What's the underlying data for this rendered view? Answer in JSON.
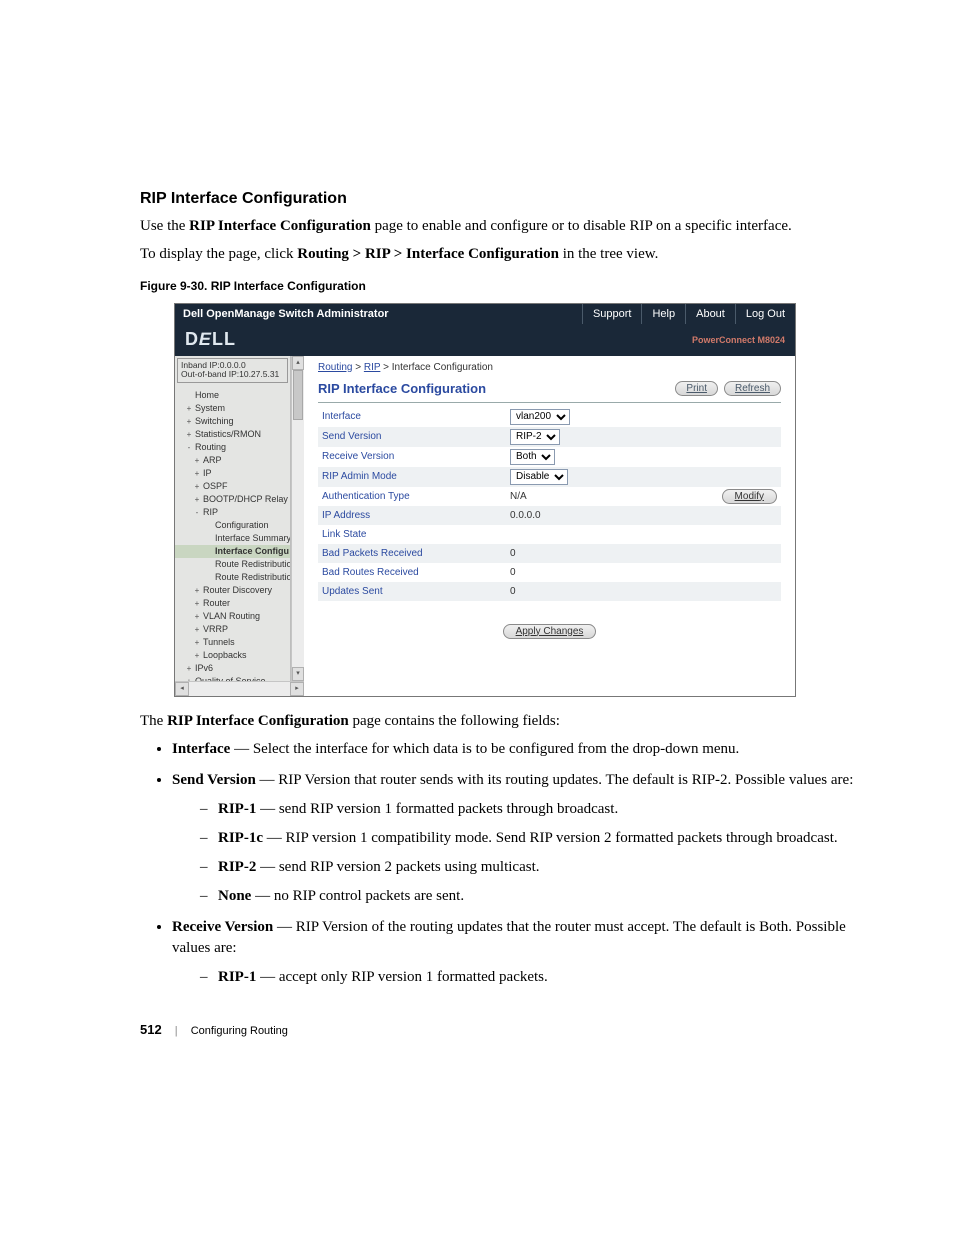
{
  "heading": "RIP Interface Configuration",
  "intro_pre": "Use the ",
  "intro_bold": "RIP Interface Configuration",
  "intro_post": " page to enable and configure or to disable RIP on a specific interface.",
  "nav_pre": "To display the page, click ",
  "nav_bold": "Routing > RIP > Interface Configuration",
  "nav_post": " in the tree view.",
  "figcap": "Figure 9-30.    RIP Interface Configuration",
  "ss": {
    "titlebar": {
      "title": "Dell OpenManage Switch Administrator",
      "links": [
        "Support",
        "Help",
        "About",
        "Log Out"
      ]
    },
    "brand": "DELL",
    "product": "PowerConnect M8024",
    "ipbox": {
      "inband": "Inband IP:0.0.0.0",
      "oob": "Out-of-band IP:10.27.5.31"
    },
    "tree": [
      {
        "lvl": 0,
        "exp": "",
        "label": "Home",
        "icon": "home-icon"
      },
      {
        "lvl": 0,
        "exp": "+",
        "label": "System"
      },
      {
        "lvl": 0,
        "exp": "+",
        "label": "Switching"
      },
      {
        "lvl": 0,
        "exp": "+",
        "label": "Statistics/RMON"
      },
      {
        "lvl": 0,
        "exp": "-",
        "label": "Routing"
      },
      {
        "lvl": 1,
        "exp": "+",
        "label": "ARP"
      },
      {
        "lvl": 1,
        "exp": "+",
        "label": "IP"
      },
      {
        "lvl": 1,
        "exp": "+",
        "label": "OSPF"
      },
      {
        "lvl": 1,
        "exp": "+",
        "label": "BOOTP/DHCP Relay"
      },
      {
        "lvl": 1,
        "exp": "-",
        "label": "RIP"
      },
      {
        "lvl": 2,
        "exp": "",
        "label": "Configuration"
      },
      {
        "lvl": 2,
        "exp": "",
        "label": "Interface Summary"
      },
      {
        "lvl": 2,
        "exp": "",
        "label": "Interface Configu",
        "sel": true
      },
      {
        "lvl": 2,
        "exp": "",
        "label": "Route Redistributio"
      },
      {
        "lvl": 2,
        "exp": "",
        "label": "Route Redistributio"
      },
      {
        "lvl": 1,
        "exp": "+",
        "label": "Router Discovery"
      },
      {
        "lvl": 1,
        "exp": "+",
        "label": "Router"
      },
      {
        "lvl": 1,
        "exp": "+",
        "label": "VLAN Routing"
      },
      {
        "lvl": 1,
        "exp": "+",
        "label": "VRRP"
      },
      {
        "lvl": 1,
        "exp": "+",
        "label": "Tunnels"
      },
      {
        "lvl": 1,
        "exp": "+",
        "label": "Loopbacks"
      },
      {
        "lvl": 0,
        "exp": "+",
        "label": "IPv6"
      },
      {
        "lvl": 0,
        "exp": "+",
        "label": "Quality of Service"
      }
    ],
    "breadcrumb": {
      "a": "Routing",
      "b": "RIP",
      "c": "Interface Configuration"
    },
    "pageTitle": "RIP Interface Configuration",
    "buttons": {
      "print": "Print",
      "refresh": "Refresh",
      "modify": "Modify",
      "apply": "Apply Changes"
    },
    "fields": [
      {
        "label": "Interface",
        "type": "select",
        "value": "vlan200"
      },
      {
        "label": "Send Version",
        "type": "select",
        "value": "RIP-2"
      },
      {
        "label": "Receive Version",
        "type": "select",
        "value": "Both"
      },
      {
        "label": "RIP Admin Mode",
        "type": "select",
        "value": "Disable"
      },
      {
        "label": "Authentication Type",
        "type": "textbtn",
        "value": "N/A"
      },
      {
        "label": "IP Address",
        "type": "text",
        "value": "0.0.0.0"
      },
      {
        "label": "Link State",
        "type": "text",
        "value": ""
      },
      {
        "label": "Bad Packets Received",
        "type": "text",
        "value": "0"
      },
      {
        "label": "Bad Routes Received",
        "type": "text",
        "value": "0"
      },
      {
        "label": "Updates Sent",
        "type": "text",
        "value": "0"
      }
    ]
  },
  "after_fig_pre": "The ",
  "after_fig_bold": "RIP Interface Configuration",
  "after_fig_post": " page contains the following fields:",
  "bullets": {
    "b0_bold": "Interface",
    "b0_rest": " — Select the interface for which data is to be configured from the drop-down menu.",
    "b1_bold": "Send Version",
    "b1_rest": " — RIP Version that router sends with its routing updates. The default is RIP-2. Possible values are:",
    "b1s": [
      {
        "b": "RIP-1",
        "r": " — send RIP version 1 formatted packets through broadcast."
      },
      {
        "b": "RIP-1c",
        "r": " — RIP version 1 compatibility mode. Send RIP version 2 formatted packets through broadcast."
      },
      {
        "b": "RIP-2",
        "r": " — send RIP version 2 packets using multicast."
      },
      {
        "b": "None",
        "r": " — no RIP control packets are sent."
      }
    ],
    "b2_bold": "Receive Version",
    "b2_rest": " — RIP Version of the routing updates that the router must accept. The default is Both. Possible values are:",
    "b2s": [
      {
        "b": "RIP-1",
        "r": " — accept only RIP version 1 formatted packets."
      }
    ]
  },
  "footer": {
    "page": "512",
    "section": "Configuring Routing"
  }
}
